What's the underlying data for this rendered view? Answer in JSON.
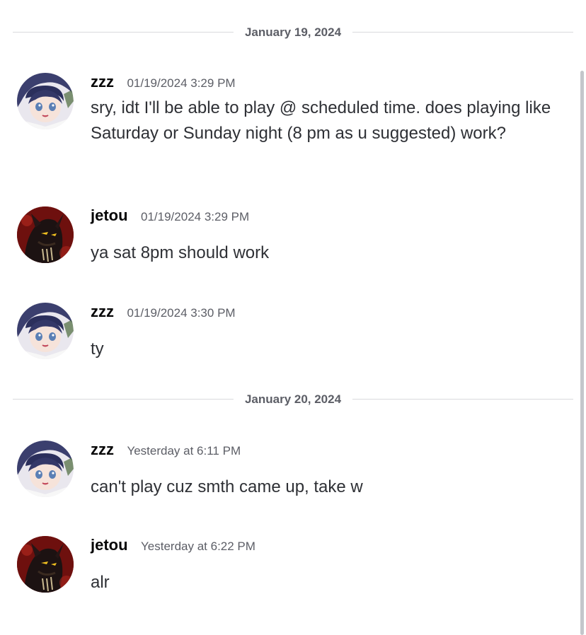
{
  "dividers": [
    {
      "label": "January 19, 2024"
    },
    {
      "label": "January 20, 2024"
    }
  ],
  "messages": [
    {
      "username": "zzz",
      "timestamp": "01/19/2024 3:29 PM",
      "text": "sry, idt I'll be able to play @ scheduled time. does playing like Saturday or Sunday night (8 pm as u suggested) work?",
      "avatar": "anime-girl-avatar"
    },
    {
      "username": "jetou",
      "timestamp": "01/19/2024 3:29 PM",
      "text": "ya sat 8pm should work",
      "avatar": "red-demon-avatar"
    },
    {
      "username": "zzz",
      "timestamp": "01/19/2024 3:30 PM",
      "text": "ty",
      "avatar": "anime-girl-avatar"
    },
    {
      "username": "zzz",
      "timestamp": "Yesterday at 6:11 PM",
      "text": "can't play cuz smth came up, take w",
      "avatar": "anime-girl-avatar"
    },
    {
      "username": "jetou",
      "timestamp": "Yesterday at 6:22 PM",
      "text": "alr",
      "avatar": "red-demon-avatar"
    }
  ],
  "colors": {
    "background": "#ffffff",
    "username": "#060607",
    "timestamp": "#5c5e66",
    "message_text": "#2e3035",
    "divider_line": "#d9dadd"
  }
}
